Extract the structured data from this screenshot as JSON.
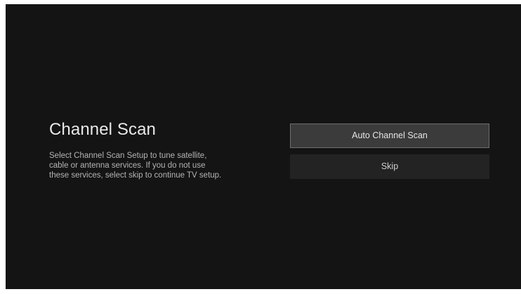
{
  "screen": {
    "title": "Channel Scan",
    "description_lines": [
      "Select Channel Scan Setup to tune satellite,",
      "cable or antenna services. If you do not use",
      "these services, select skip to continue TV setup."
    ]
  },
  "options": [
    {
      "label": "Auto Channel Scan",
      "focused": true
    },
    {
      "label": "Skip",
      "focused": false
    }
  ],
  "colors": {
    "background": "#141414",
    "focused_button": "#3b3b3b",
    "button": "#232323"
  }
}
